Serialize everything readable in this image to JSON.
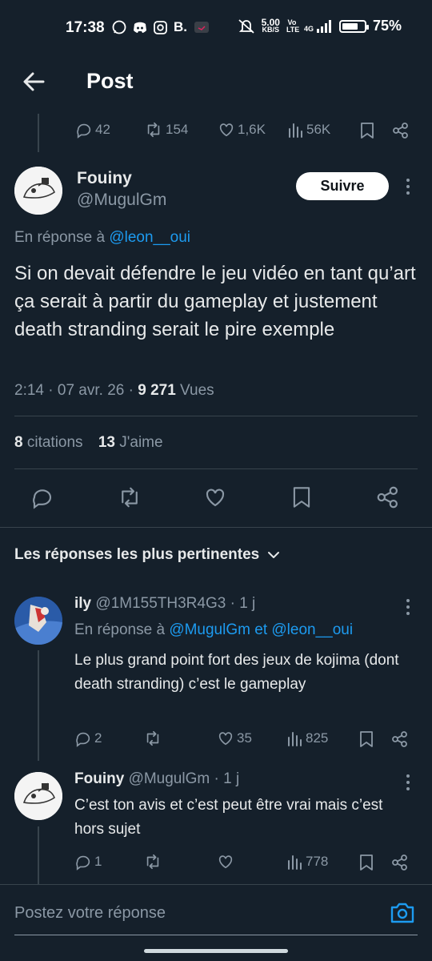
{
  "status_bar": {
    "time": "17:38",
    "app_b": "B.",
    "speed_value": "5.00",
    "speed_unit": "KB/S",
    "volte": "Vo LTE",
    "network": "4G",
    "battery_pct": "75%",
    "battery_level": 0.75
  },
  "header": {
    "title": "Post"
  },
  "prev_tweet_actions": {
    "replies": "42",
    "reposts": "154",
    "likes": "1,6K",
    "views": "56K"
  },
  "main_post": {
    "name": "Fouiny",
    "handle": "@MugulGm",
    "follow_label": "Suivre",
    "reply_to_prefix": "En réponse à",
    "reply_to_handle": "@leon__oui",
    "text": "Si on devait défendre le jeu vidéo en tant qu’art ça serait à partir du gameplay et justement death stranding serait le pire exemple",
    "time": "2:14",
    "date": "07 avr. 26",
    "sep": "·",
    "views_count": "9 271",
    "views_label": "Vues",
    "quotes_count": "8",
    "quotes_label": "citations",
    "likes_count": "13",
    "likes_label": "J'aime"
  },
  "replies_sort": {
    "label": "Les réponses les plus pertinentes"
  },
  "replies": [
    {
      "name": "ily",
      "handle": "@1M155TH3R4G3",
      "age": "· 1 j",
      "reply_to_prefix": "En réponse à",
      "reply_to_1": "@MugulGm",
      "reply_to_and": "et",
      "reply_to_2": "@leon__oui",
      "text": "Le plus grand point fort des jeux de kojima (dont death stranding) c’est le gameplay",
      "replies": "2",
      "reposts": "",
      "likes": "35",
      "views": "825"
    },
    {
      "name": "Fouiny",
      "handle": "@MugulGm",
      "age": "· 1 j",
      "text": "C’est ton avis et c’est peut être vrai mais c’est hors sujet",
      "replies": "1",
      "reposts": "",
      "likes": "",
      "views": "778"
    }
  ],
  "composer": {
    "placeholder": "Postez votre réponse"
  },
  "colors": {
    "background": "#15202b",
    "accent": "#1d9bf0",
    "muted": "#8b98a5",
    "divider": "#38444d"
  },
  "icons": [
    "back-arrow-icon",
    "reply-icon",
    "repost-icon",
    "like-icon",
    "views-icon",
    "bookmark-icon",
    "share-icon",
    "more-icon",
    "chevron-down-icon",
    "camera-icon"
  ]
}
